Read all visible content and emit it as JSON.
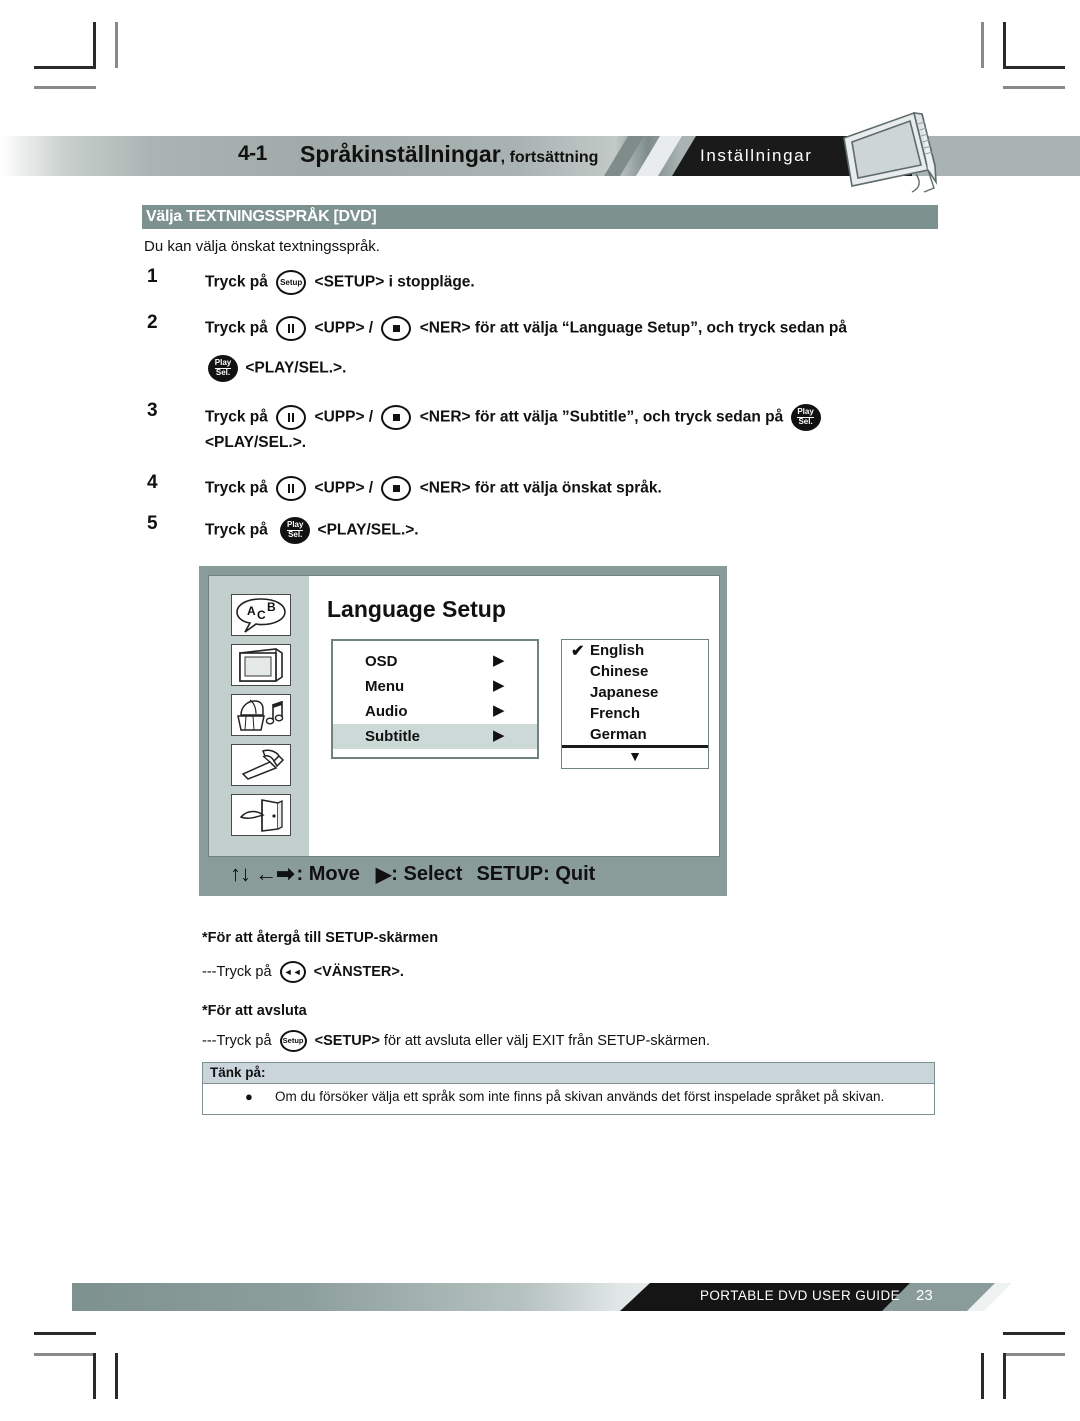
{
  "header": {
    "section_number": "4-1",
    "title": "Språkinställningar",
    "title_suffix": ", fortsättning",
    "tag": "Inställningar",
    "device_icon": "portable-dvd-player-illustration"
  },
  "section": {
    "bar_label": "Välja TEXTNINGSSPRÅK [DVD]",
    "bar_color": "#7d918e",
    "intro": "Du kan välja önskat textningsspråk."
  },
  "steps": [
    {
      "num": "1",
      "line1_a": "Tryck på",
      "key1": "Setup",
      "line1_b": "<SETUP> i stoppläge.",
      "line2": ""
    },
    {
      "num": "2",
      "line1_a": "Tryck på",
      "key1": "pause",
      "line1_b": "<UPP> /",
      "key2": "stop",
      "line1_c": "<NER> för att välja “Language Setup”, och tryck sedan på",
      "line2_key": "Play/Sel.",
      "line2_text": "<PLAY/SEL.>."
    },
    {
      "num": "3",
      "line1_a": "Tryck på",
      "key1": "pause",
      "line1_b": "<UPP> /",
      "key2": "stop",
      "line1_c": "<NER> för att välja ”Subtitle”, och tryck sedan på",
      "line2_text": "<PLAY/SEL.>."
    },
    {
      "num": "4",
      "line1_a": "Tryck på",
      "key1": "pause",
      "line1_b": "<UPP> /",
      "key2": "stop",
      "line1_c": "<NER> för att välja önskat språk."
    },
    {
      "num": "5",
      "line1_a": "Tryck på",
      "key1": "Play/Sel.",
      "line1_b": "<PLAY/SEL.>."
    }
  ],
  "osd": {
    "title": "Language Setup",
    "sidebar_icons": [
      "language-speech-bubble-icon",
      "tv-display-icon",
      "audio-speaker-music-icon",
      "hammer-preferences-icon",
      "exit-door-icon"
    ],
    "menu_items": [
      {
        "label": "OSD",
        "arrow": "▶",
        "selected": false
      },
      {
        "label": "Menu",
        "arrow": "▶",
        "selected": false
      },
      {
        "label": "Audio",
        "arrow": "▶",
        "selected": false
      },
      {
        "label": "Subtitle",
        "arrow": "▶",
        "selected": true
      }
    ],
    "languages": [
      {
        "label": "English",
        "checked": true
      },
      {
        "label": "Chinese",
        "checked": false
      },
      {
        "label": "Japanese",
        "checked": false
      },
      {
        "label": "French",
        "checked": false
      },
      {
        "label": "German",
        "checked": false
      }
    ],
    "scroll_down_arrow": "▼",
    "footer_arrows": "↑↓←➡",
    "footer_move": ": Move",
    "footer_select_arrow": "▶",
    "footer_select": ": Select",
    "footer_quit": "SETUP: Quit",
    "frame_color": "#8a9c99",
    "sidebar_color": "#c3cfcd",
    "highlight_color": "#cdd9d7"
  },
  "notes": {
    "back_title": "*För att återgå till SETUP-skärmen",
    "back_prefix": "---Tryck på",
    "back_key": "rewind",
    "back_label": "<VÄNSTER>.",
    "exit_title": "*För att avsluta",
    "exit_prefix": "---Tryck på",
    "exit_key": "Setup",
    "exit_label": "<SETUP>",
    "exit_rest": "för att avsluta eller välj EXIT från SETUP-skärmen."
  },
  "tank": {
    "heading": "Tänk på:",
    "bullet": "●",
    "text": "Om du försöker välja ett språk som inte finns på skivan används det först inspelade språket på skivan."
  },
  "footer": {
    "label": "PORTABLE DVD USER GUIDE",
    "page": "23"
  }
}
